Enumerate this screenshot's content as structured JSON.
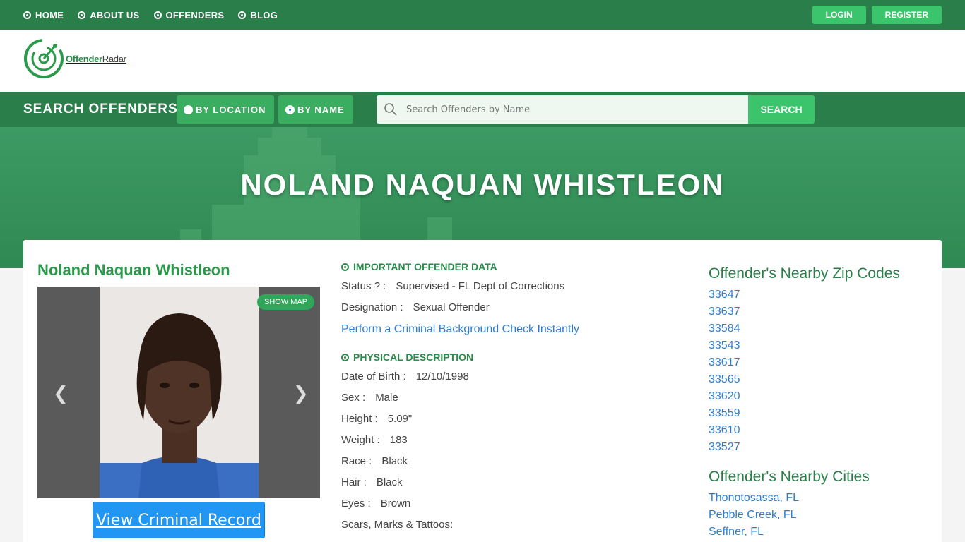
{
  "nav": {
    "items": [
      "HOME",
      "ABOUT US",
      "OFFENDERS",
      "BLOG"
    ],
    "login": "LOGIN",
    "register": "REGISTER"
  },
  "logo": {
    "brand_main": "Offender",
    "brand_sub": "Radar"
  },
  "search": {
    "title": "SEARCH OFFENDERS",
    "by_location": "BY LOCATION",
    "by_name": "BY NAME",
    "placeholder": "Search Offenders by Name",
    "button": "SEARCH"
  },
  "hero": {
    "title": "NOLAND NAQUAN WHISTLEON"
  },
  "profile": {
    "name": "Noland Naquan Whistleon",
    "show_map": "SHOW MAP",
    "view_record": "View Criminal Record"
  },
  "important": {
    "heading": "IMPORTANT OFFENDER DATA",
    "status_label": "Status ? :",
    "status_value": "Supervised - FL Dept of Corrections",
    "designation_label": "Designation :",
    "designation_value": "Sexual Offender",
    "background_link": "Perform a Criminal Background Check Instantly"
  },
  "physical": {
    "heading": "PHYSICAL DESCRIPTION",
    "rows": [
      {
        "label": "Date of Birth :",
        "value": "12/10/1998"
      },
      {
        "label": "Sex :",
        "value": "Male"
      },
      {
        "label": "Height :",
        "value": "5.09\""
      },
      {
        "label": "Weight :",
        "value": "183"
      },
      {
        "label": "Race :",
        "value": "Black"
      },
      {
        "label": "Hair :",
        "value": "Black"
      },
      {
        "label": "Eyes :",
        "value": "Brown"
      },
      {
        "label": "Scars, Marks & Tattoos:",
        "value": ""
      }
    ]
  },
  "nearby": {
    "zip_heading": "Offender's Nearby Zip Codes",
    "zips": [
      "33647",
      "33637",
      "33584",
      "33543",
      "33617",
      "33565",
      "33620",
      "33559",
      "33610",
      "33527"
    ],
    "cities_heading": "Offender's Nearby Cities",
    "cities": [
      "Thonotosassa, FL",
      "Pebble Creek, FL",
      "Seffner, FL"
    ]
  },
  "colors": {
    "brand_green": "#2a7e4a",
    "accent_green": "#3cc46d",
    "link_blue": "#2d7dd2"
  },
  "icons": [
    "radio-dot-icon",
    "search-icon",
    "chevron-left-icon",
    "chevron-right-icon"
  ]
}
